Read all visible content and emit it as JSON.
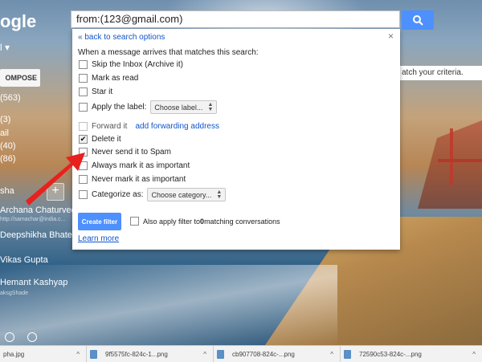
{
  "logo": "ogle",
  "search": {
    "query": "from:(123@gmail.com)"
  },
  "compose": {
    "label": "OMPOSE"
  },
  "sidebar": {
    "dropdown_fragment": "l ▾",
    "counts": [
      "(563)",
      "(3)",
      "ail",
      "(40)",
      "(86)"
    ],
    "section": "sha",
    "contacts": [
      {
        "name": "Archana Chaturved",
        "sub": "http://samachar@india.c..."
      },
      {
        "name": "Deepshikha Bhatele",
        "sub": ""
      },
      {
        "name": "Vikas Gupta",
        "sub": ""
      },
      {
        "name": "Hemant Kashyap",
        "sub": "aksgShade"
      }
    ]
  },
  "banner": "atch your criteria.",
  "filter_panel": {
    "back_link": "« back to search options",
    "close": "×",
    "intro": "When a message arrives that matches this search:",
    "options": [
      {
        "label": "Skip the Inbox (Archive it)",
        "checked": false
      },
      {
        "label": "Mark as read",
        "checked": false
      },
      {
        "label": "Star it",
        "checked": false
      },
      {
        "label": "Apply the label:",
        "checked": false,
        "select": "Choose label..."
      },
      {
        "label": "Forward it",
        "checked": false,
        "link": "add forwarding address",
        "disabled": true
      },
      {
        "label": "Delete it",
        "checked": true
      },
      {
        "label": "Never send it to Spam",
        "checked": false
      },
      {
        "label": "Always mark it as important",
        "checked": false
      },
      {
        "label": "Never mark it as important",
        "checked": false
      },
      {
        "label": "Categorize as:",
        "checked": false,
        "select": "Choose category..."
      }
    ],
    "create_button": "Create filter",
    "also_apply": "Also apply filter to ",
    "also_apply_count": "0",
    "also_apply_suffix": " matching conversations",
    "learn_more": "Learn more"
  },
  "downloads": [
    {
      "name": "pha.jpg"
    },
    {
      "name": "9f5575fc-824c-1...png"
    },
    {
      "name": "cb907708-824c-...png"
    },
    {
      "name": "72590c53-824c-...png"
    }
  ],
  "colors": {
    "accent": "#4d90fe",
    "link": "#1155cc",
    "arrow": "#e8211e"
  }
}
